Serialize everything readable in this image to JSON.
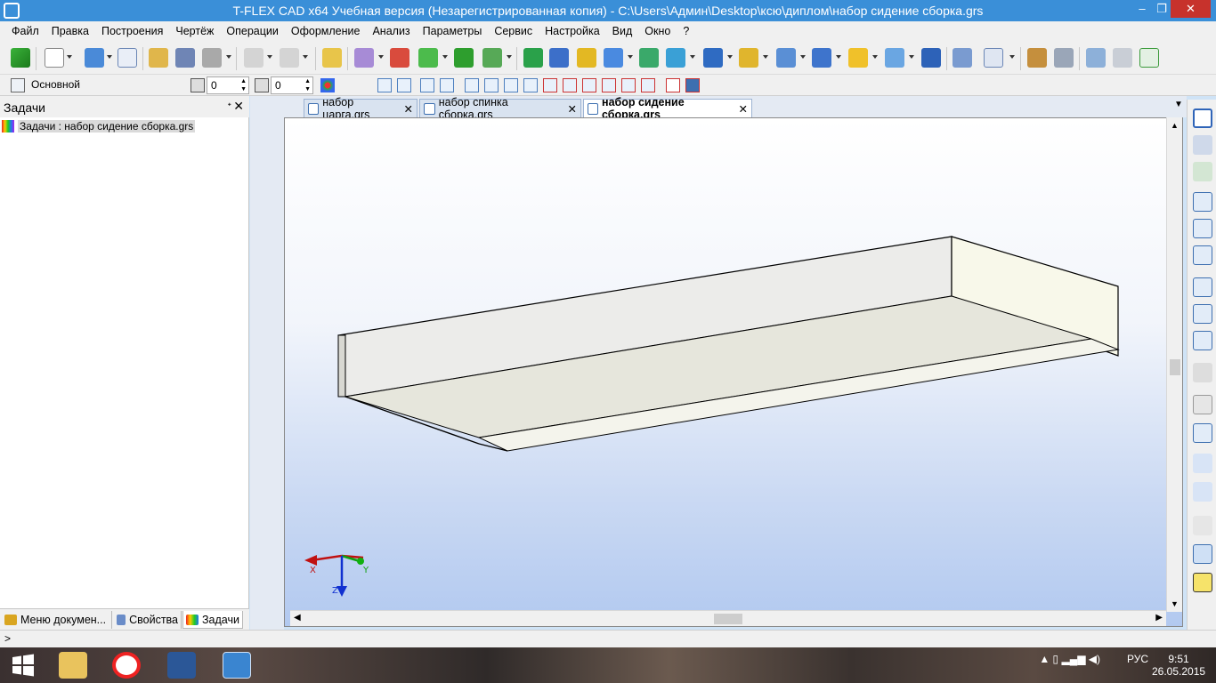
{
  "window": {
    "title": "T-FLEX CAD x64 Учебная версия (Незарегистрированная копия) - C:\\Users\\Админ\\Desktop\\ксю\\диплом\\набор сидение сборка.grs",
    "controls": {
      "minimize": "‒",
      "restore": "❐",
      "close": "✕"
    }
  },
  "menu": [
    "Файл",
    "Правка",
    "Построения",
    "Чертёж",
    "Операции",
    "Оформление",
    "Анализ",
    "Параметры",
    "Сервис",
    "Настройка",
    "Вид",
    "Окно",
    "?"
  ],
  "toolbar2": {
    "layer_label": "Основной",
    "spin1": "0",
    "spin2": "0"
  },
  "left_panel": {
    "title": "Задачи",
    "pin": "ᐩ",
    "close": "✕",
    "task_item": "Задачи : набор сидение сборка.grs",
    "tabs": [
      {
        "label": "Меню докумен...",
        "color": "#d9a520"
      },
      {
        "label": "Свойства",
        "color": "#6a8cc8"
      },
      {
        "label": "Задачи",
        "color": "#2fa34a"
      }
    ]
  },
  "doc_tabs": [
    {
      "label": "набор царга.grs",
      "active": false
    },
    {
      "label": "набор спинка сборка.grs",
      "active": false
    },
    {
      "label": "набор сидение сборка.grs",
      "active": true
    }
  ],
  "axes": {
    "x": "X",
    "y": "Y",
    "z": "Z"
  },
  "status": {
    "text": ">"
  },
  "taskbar": {
    "lang": "РУС",
    "time": "9:51",
    "date": "26.05.2015"
  },
  "colors": {
    "title_bg": "#3a8fd8",
    "close_btn": "#c7322c",
    "model_top": "#ecece6",
    "model_side": "#f8f8ea"
  }
}
